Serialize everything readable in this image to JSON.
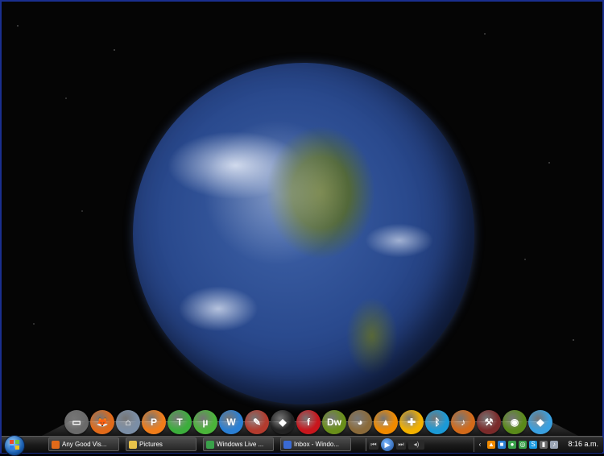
{
  "desktop": {
    "wallpaper": "earth-from-space"
  },
  "dock": {
    "items": [
      {
        "name": "desktop-icon",
        "glyph": "▭",
        "color": "#6a6a6a"
      },
      {
        "name": "firefox-icon",
        "glyph": "🦊",
        "color": "#e06a1a"
      },
      {
        "name": "network-icon",
        "glyph": "⌂",
        "color": "#7b8ea6"
      },
      {
        "name": "app-p-icon",
        "glyph": "P",
        "color": "#f07d1a"
      },
      {
        "name": "app-t-icon",
        "glyph": "T",
        "color": "#3cae3c"
      },
      {
        "name": "utorrent-icon",
        "glyph": "µ",
        "color": "#4bb53a"
      },
      {
        "name": "app-w-icon",
        "glyph": "W",
        "color": "#2a7fd4"
      },
      {
        "name": "paint-icon",
        "glyph": "✎",
        "color": "#b33b2e"
      },
      {
        "name": "inkscape-icon",
        "glyph": "◆",
        "color": "#222222"
      },
      {
        "name": "flash-icon",
        "glyph": "f",
        "color": "#c8161d"
      },
      {
        "name": "dreamweaver-icon",
        "glyph": "Dw",
        "color": "#6a8f1a"
      },
      {
        "name": "gimp-icon",
        "glyph": "◕",
        "color": "#8a6a3a"
      },
      {
        "name": "vlc-icon",
        "glyph": "▲",
        "color": "#f08a00"
      },
      {
        "name": "puzzle-icon",
        "glyph": "✚",
        "color": "#f2b100"
      },
      {
        "name": "bluetooth-icon",
        "glyph": "ᛒ",
        "color": "#1c9ad6"
      },
      {
        "name": "audio-icon",
        "glyph": "♪",
        "color": "#d26a1a"
      },
      {
        "name": "tools-icon",
        "glyph": "⚒",
        "color": "#7a2a2a"
      },
      {
        "name": "nvidia-icon",
        "glyph": "◉",
        "color": "#5a8a1a"
      },
      {
        "name": "recycle-icon",
        "glyph": "◆",
        "color": "#3aa0e0"
      }
    ]
  },
  "taskbar": {
    "buttons": [
      {
        "label": "Any Good Vis...",
        "icon_color": "#e06a1a"
      },
      {
        "label": "Pictures",
        "icon_color": "#e8c24a"
      },
      {
        "label": "Windows Live ...",
        "icon_color": "#3aa14a"
      },
      {
        "label": "Inbox - Windo...",
        "icon_color": "#3a6ad4"
      }
    ],
    "media": {
      "prev": "⏮",
      "play": "▶",
      "next": "⏭",
      "volume": "◂)"
    },
    "tray": {
      "expand_glyph": "‹",
      "icons": [
        {
          "name": "tray-vlc-icon",
          "glyph": "▲",
          "color": "#f08a00"
        },
        {
          "name": "tray-app-icon",
          "glyph": "■",
          "color": "#2a7fd4"
        },
        {
          "name": "tray-green-icon",
          "glyph": "●",
          "color": "#3aa14a"
        },
        {
          "name": "tray-network-icon",
          "glyph": "◎",
          "color": "#3aa14a"
        },
        {
          "name": "tray-skype-icon",
          "glyph": "S",
          "color": "#1a9ae0"
        },
        {
          "name": "tray-battery-icon",
          "glyph": "▮",
          "color": "#6a6a6a"
        },
        {
          "name": "tray-volume-icon",
          "glyph": "♪",
          "color": "#9aa4b4"
        }
      ],
      "clock": "8:16 a.m."
    }
  }
}
